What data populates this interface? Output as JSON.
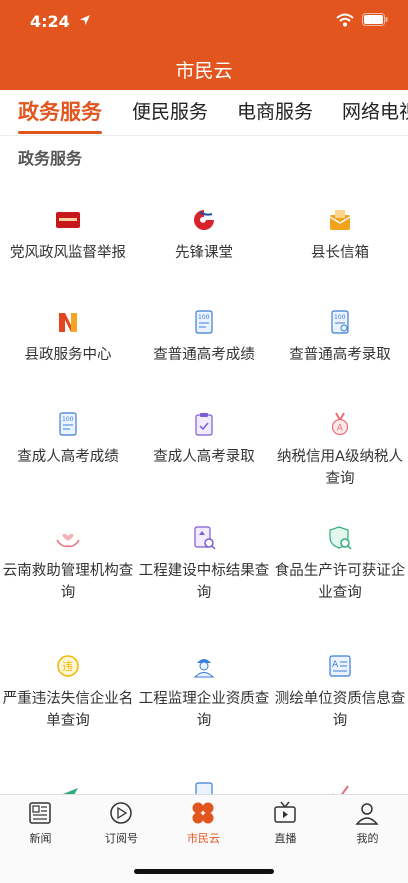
{
  "status": {
    "time": "4:24"
  },
  "header": {
    "title": "市民云"
  },
  "tabs": [
    {
      "label": "政务服务",
      "active": true
    },
    {
      "label": "便民服务",
      "active": false
    },
    {
      "label": "电商服务",
      "active": false
    },
    {
      "label": "网络电视",
      "active": false
    }
  ],
  "section": {
    "title": "政务服务"
  },
  "services": [
    {
      "label": "党风政风监督举报",
      "icon": "report-badge-icon"
    },
    {
      "label": "先锋课堂",
      "icon": "pioneer-logo-icon"
    },
    {
      "label": "县长信箱",
      "icon": "mailbox-icon"
    },
    {
      "label": "县政服务中心",
      "icon": "service-center-logo-icon"
    },
    {
      "label": "查普通高考成绩",
      "icon": "score-sheet-icon"
    },
    {
      "label": "查普通高考录取",
      "icon": "admission-sheet-icon"
    },
    {
      "label": "查成人高考成绩",
      "icon": "score-sheet-icon"
    },
    {
      "label": "查成人高考录取",
      "icon": "clipboard-check-icon"
    },
    {
      "label": "纳税信用A级纳税人查询",
      "icon": "medal-icon"
    },
    {
      "label": "云南救助管理机构查询",
      "icon": "hands-heart-icon"
    },
    {
      "label": "工程建设中标结果查询",
      "icon": "document-search-icon"
    },
    {
      "label": "食品生产许可获证企业查询",
      "icon": "shield-search-icon"
    },
    {
      "label": "严重违法失信企业名单查询",
      "icon": "violation-badge-icon"
    },
    {
      "label": "工程监理企业资质查询",
      "icon": "engineer-icon"
    },
    {
      "label": "测绘单位资质信息查询",
      "icon": "survey-icon"
    },
    {
      "label": "",
      "icon": "plane-icon"
    },
    {
      "label": "",
      "icon": "document-icon"
    },
    {
      "label": "",
      "icon": "check-icon"
    }
  ],
  "tabbar": [
    {
      "label": "新闻",
      "icon": "news-icon",
      "active": false
    },
    {
      "label": "订阅号",
      "icon": "subscription-icon",
      "active": false
    },
    {
      "label": "市民云",
      "icon": "clover-icon",
      "active": true
    },
    {
      "label": "直播",
      "icon": "tv-icon",
      "active": false
    },
    {
      "label": "我的",
      "icon": "user-icon",
      "active": false
    }
  ],
  "colors": {
    "brand": "#e2551f",
    "text": "#333333"
  }
}
